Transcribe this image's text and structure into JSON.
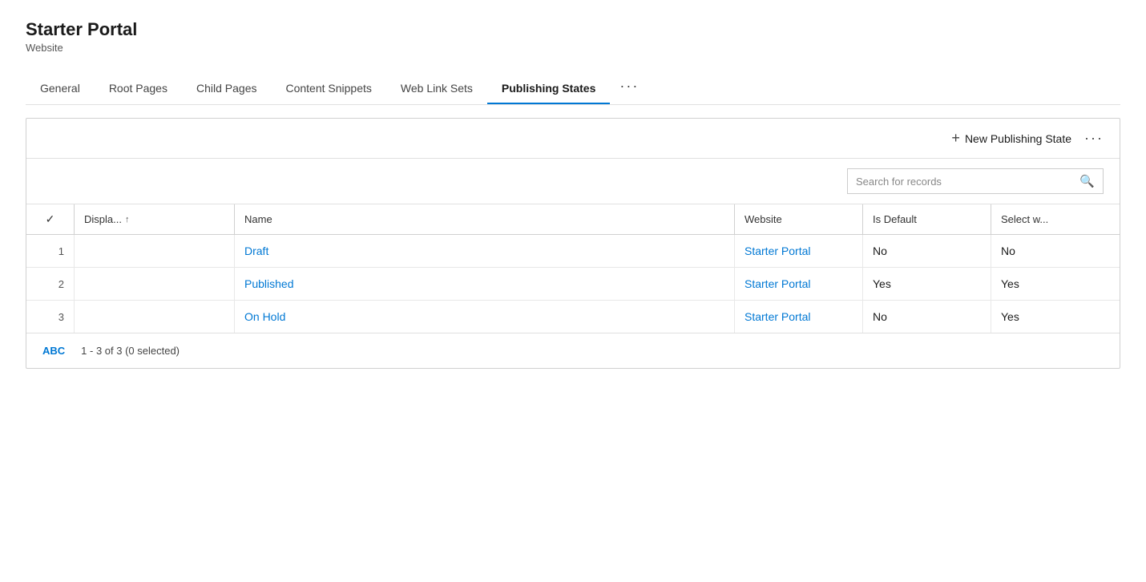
{
  "header": {
    "title": "Starter Portal",
    "subtitle": "Website"
  },
  "tabs": [
    {
      "id": "general",
      "label": "General",
      "active": false
    },
    {
      "id": "root-pages",
      "label": "Root Pages",
      "active": false
    },
    {
      "id": "child-pages",
      "label": "Child Pages",
      "active": false
    },
    {
      "id": "content-snippets",
      "label": "Content Snippets",
      "active": false
    },
    {
      "id": "web-link-sets",
      "label": "Web Link Sets",
      "active": false
    },
    {
      "id": "publishing-states",
      "label": "Publishing States",
      "active": true
    }
  ],
  "tabs_more": "···",
  "toolbar": {
    "new_btn_label": "New Publishing State",
    "more_options": "···"
  },
  "search": {
    "placeholder": "Search for records"
  },
  "table": {
    "columns": [
      "✓",
      "Displa...↑",
      "Name",
      "Website",
      "Is Default",
      "Select w..."
    ],
    "rows": [
      {
        "num": "1",
        "name": "Draft",
        "website": "Starter Portal",
        "is_default": "No",
        "select_w": "No"
      },
      {
        "num": "2",
        "name": "Published",
        "website": "Starter Portal",
        "is_default": "Yes",
        "select_w": "Yes"
      },
      {
        "num": "3",
        "name": "On Hold",
        "website": "Starter Portal",
        "is_default": "No",
        "select_w": "Yes"
      }
    ]
  },
  "footer": {
    "abc_label": "ABC",
    "range_text": "1 - 3 of 3 (0 selected)"
  }
}
